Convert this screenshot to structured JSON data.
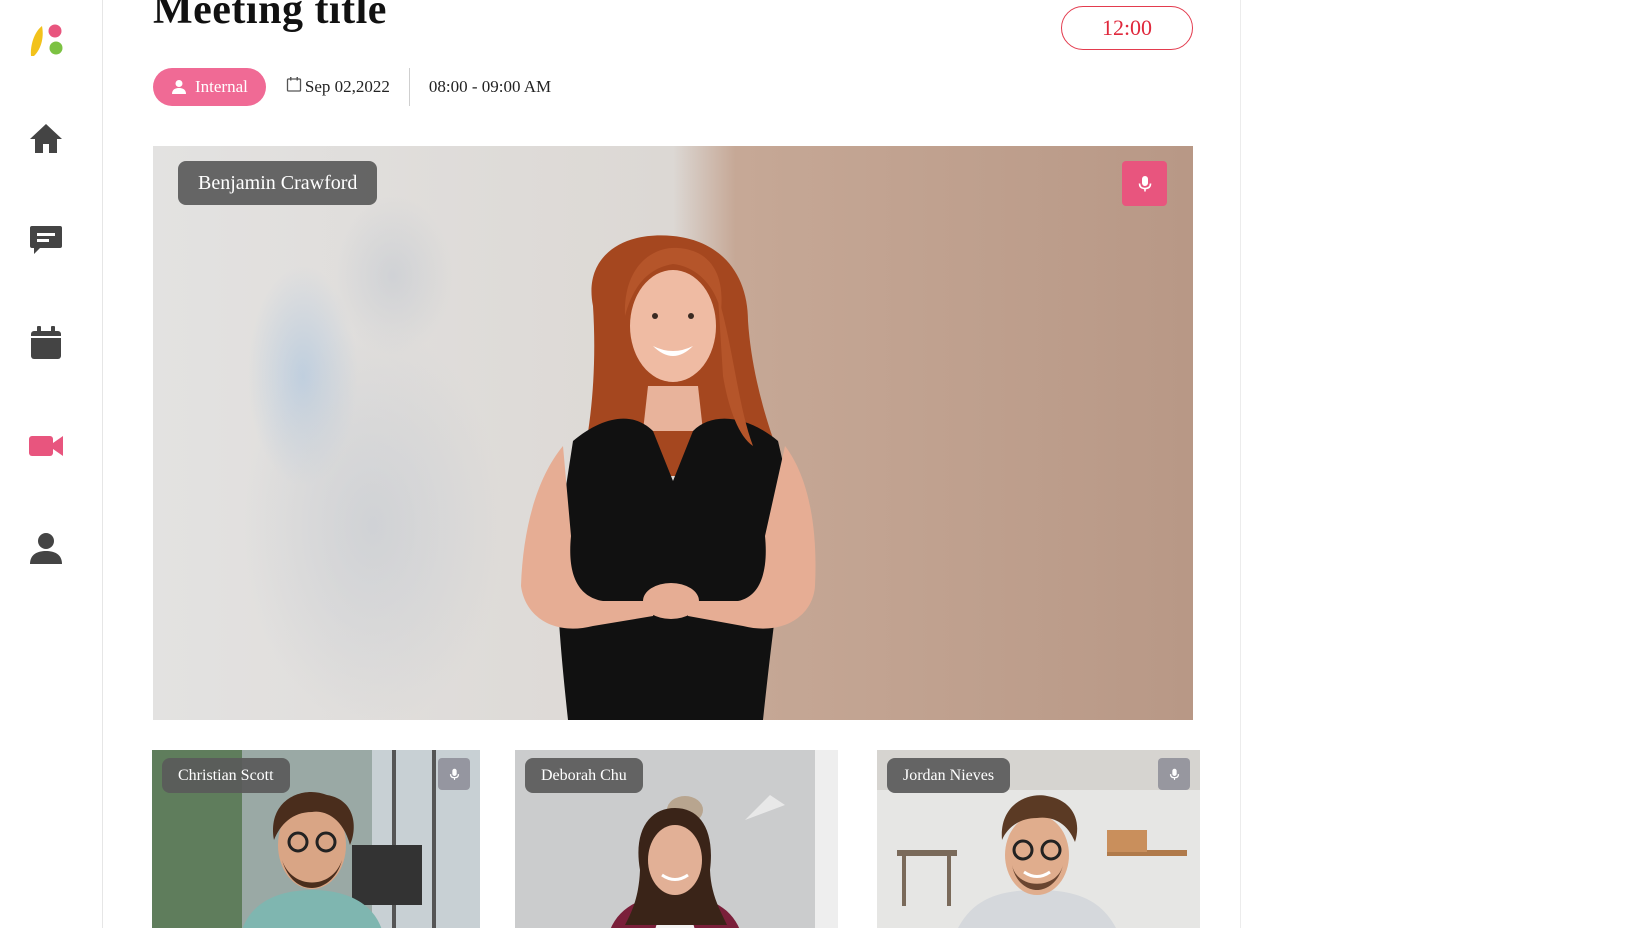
{
  "app": {
    "nav": [
      {
        "name": "home-icon",
        "color": "#444444"
      },
      {
        "name": "chat-icon",
        "color": "#444444"
      },
      {
        "name": "calendar-icon",
        "color": "#444444"
      },
      {
        "name": "video-camera-icon",
        "color": "#e8557e",
        "active": true
      },
      {
        "name": "person-icon",
        "color": "#444444"
      }
    ]
  },
  "header": {
    "title": "Meeting title",
    "timer": "12:00",
    "badge_label": "Internal",
    "date": "Sep 02,2022",
    "time_range": "08:00 - 09:00 AM"
  },
  "main_speaker": {
    "name": "Benjamin Crawford",
    "mic": "mic-icon"
  },
  "participants": [
    {
      "name": "Christian Scott",
      "mic": true
    },
    {
      "name": "Deborah Chu",
      "mic": false
    },
    {
      "name": "Jordan Nieves",
      "mic": true
    }
  ],
  "colors": {
    "accent": "#e8557e",
    "badge": "#f06a95",
    "timer": "#e0283c",
    "name_tag": "#5a5a5a"
  }
}
